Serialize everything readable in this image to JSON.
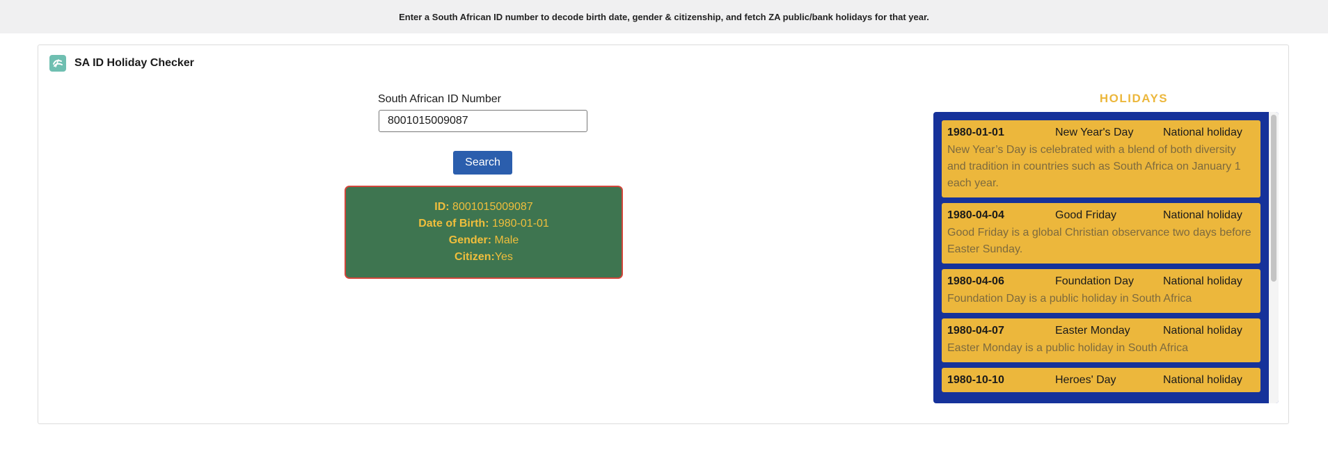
{
  "banner": {
    "text": "Enter a South African ID number to decode birth date, gender & citizenship, and fetch ZA public/bank holidays for that year."
  },
  "app": {
    "title": "SA ID Holiday Checker",
    "icon": "app-logo-icon",
    "icon_color": "#6fbfb1"
  },
  "form": {
    "label": "South African ID Number",
    "value": "8001015009087",
    "search_label": "Search",
    "button_color": "#2b5ead"
  },
  "result": {
    "id_label": "ID:",
    "id_value": "8001015009087",
    "dob_label": "Date of Birth:",
    "dob_value": "1980-01-01",
    "gender_label": "Gender:",
    "gender_value": "Male",
    "citizen_label": "Citizen:",
    "citizen_value": "Yes",
    "bg_color": "#3e7550",
    "border_color": "#d2463b",
    "text_color": "#f0be3c"
  },
  "holidays": {
    "title": "HOLIDAYS",
    "box_color": "#16329a",
    "card_color": "#ecb73c",
    "items": [
      {
        "date": "1980-01-01",
        "name": "New Year's Day",
        "type": "National holiday",
        "description": "New Year’s Day is celebrated with a blend of both diversity and tradition in countries such as South Africa on January 1 each year."
      },
      {
        "date": "1980-04-04",
        "name": "Good Friday",
        "type": "National holiday",
        "description": "Good Friday is a global Christian observance two days before Easter Sunday."
      },
      {
        "date": "1980-04-06",
        "name": "Foundation Day",
        "type": "National holiday",
        "description": "Foundation Day is a public holiday in South Africa"
      },
      {
        "date": "1980-04-07",
        "name": "Easter Monday",
        "type": "National holiday",
        "description": "Easter Monday is a public holiday in South Africa"
      },
      {
        "date": "1980-10-10",
        "name": "Heroes' Day",
        "type": "National holiday",
        "description": ""
      }
    ]
  }
}
